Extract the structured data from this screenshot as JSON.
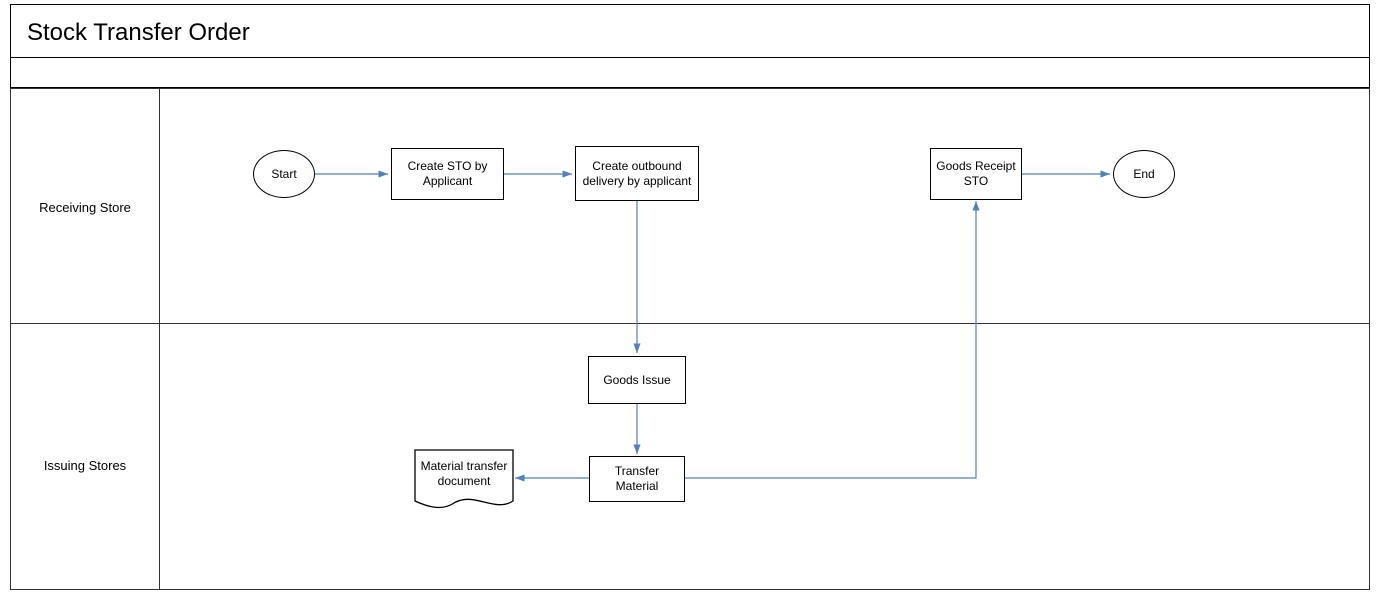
{
  "diagram": {
    "title": "Stock Transfer Order",
    "lanes": {
      "receiving": "Receiving Store",
      "issuing": "Issuing Stores"
    },
    "nodes": {
      "start": "Start",
      "create_sto": "Create STO by Applicant",
      "create_outbound": "Create outbound delivery by applicant",
      "goods_receipt": "Goods Receipt STO",
      "end": "End",
      "goods_issue": "Goods Issue",
      "transfer_material": "Transfer Material",
      "material_transfer_doc": "Material transfer document"
    }
  },
  "colors": {
    "arrow": "#4f81bd"
  }
}
